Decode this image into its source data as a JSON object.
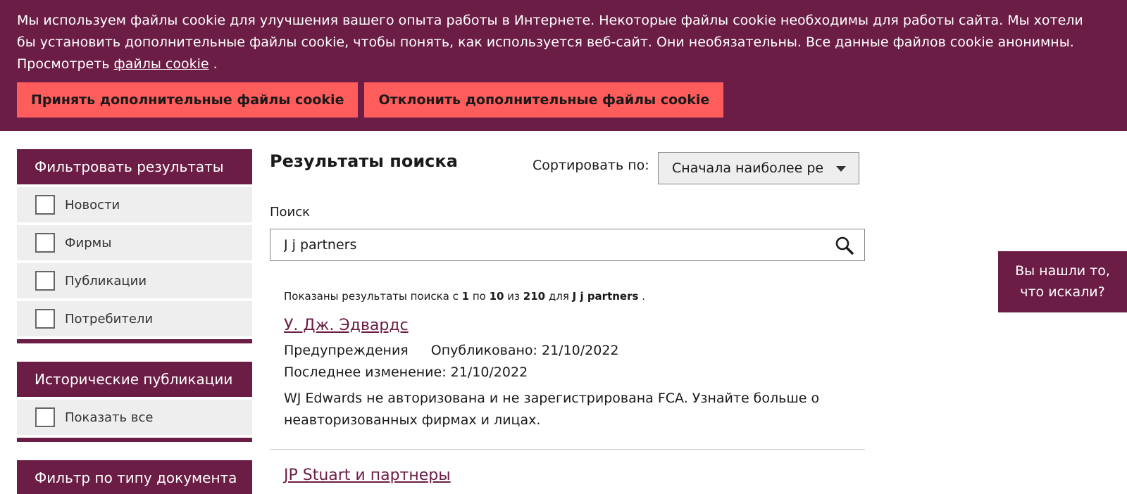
{
  "cookie_banner": {
    "text": "Мы используем файлы cookie для улучшения вашего опыта работы в Интернете. Некоторые файлы cookie необходимы для работы сайта. Мы хотели бы установить дополнительные файлы cookie, чтобы понять, как используется веб-сайт. Они необязательны. Все данные файлов cookie анонимны. Просмотреть",
    "link": "файлы cookie",
    "after_link": ".",
    "accept": "Принять дополнительные файлы cookie",
    "reject": "Отклонить дополнительные файлы cookie"
  },
  "sidebar": {
    "filter_title": "Фильтровать результаты",
    "filters": [
      "Новости",
      "Фирмы",
      "Публикации",
      "Потребители"
    ],
    "historical_title": "Исторические публикации",
    "historical_items": [
      "Показать все"
    ],
    "doctype_title": "Фильтр по типу документа"
  },
  "main": {
    "title": "Результаты поиска",
    "sort_label": "Сортировать по:",
    "sort_value": "Сначала наиболее ре",
    "search_label": "Поиск",
    "search_value": "J j partners",
    "summary": {
      "prefix": "Показаны результаты поиска с",
      "from": "1",
      "to_word": "по",
      "to": "10",
      "of_word": "из",
      "total": "210",
      "for_word": "для",
      "query": "J j partners",
      "suffix": "."
    },
    "results": [
      {
        "title": "У. Дж. Эдвардс",
        "type": "Предупреждения",
        "published": "Опубликовано: 21/10/2022",
        "modified": "Последнее изменение: 21/10/2022",
        "description": "WJ Edwards не авторизована и не зарегистрирована FCA. Узнайте больше о неавторизованных фирмах и лицах."
      },
      {
        "title": "JP Stuart и партнеры"
      }
    ]
  },
  "feedback": {
    "line1": "Вы нашли то,",
    "line2": "что искали?"
  },
  "colors": {
    "brand": "#6b1d45",
    "button": "#ff5c5c",
    "panel": "#eeeeee"
  }
}
